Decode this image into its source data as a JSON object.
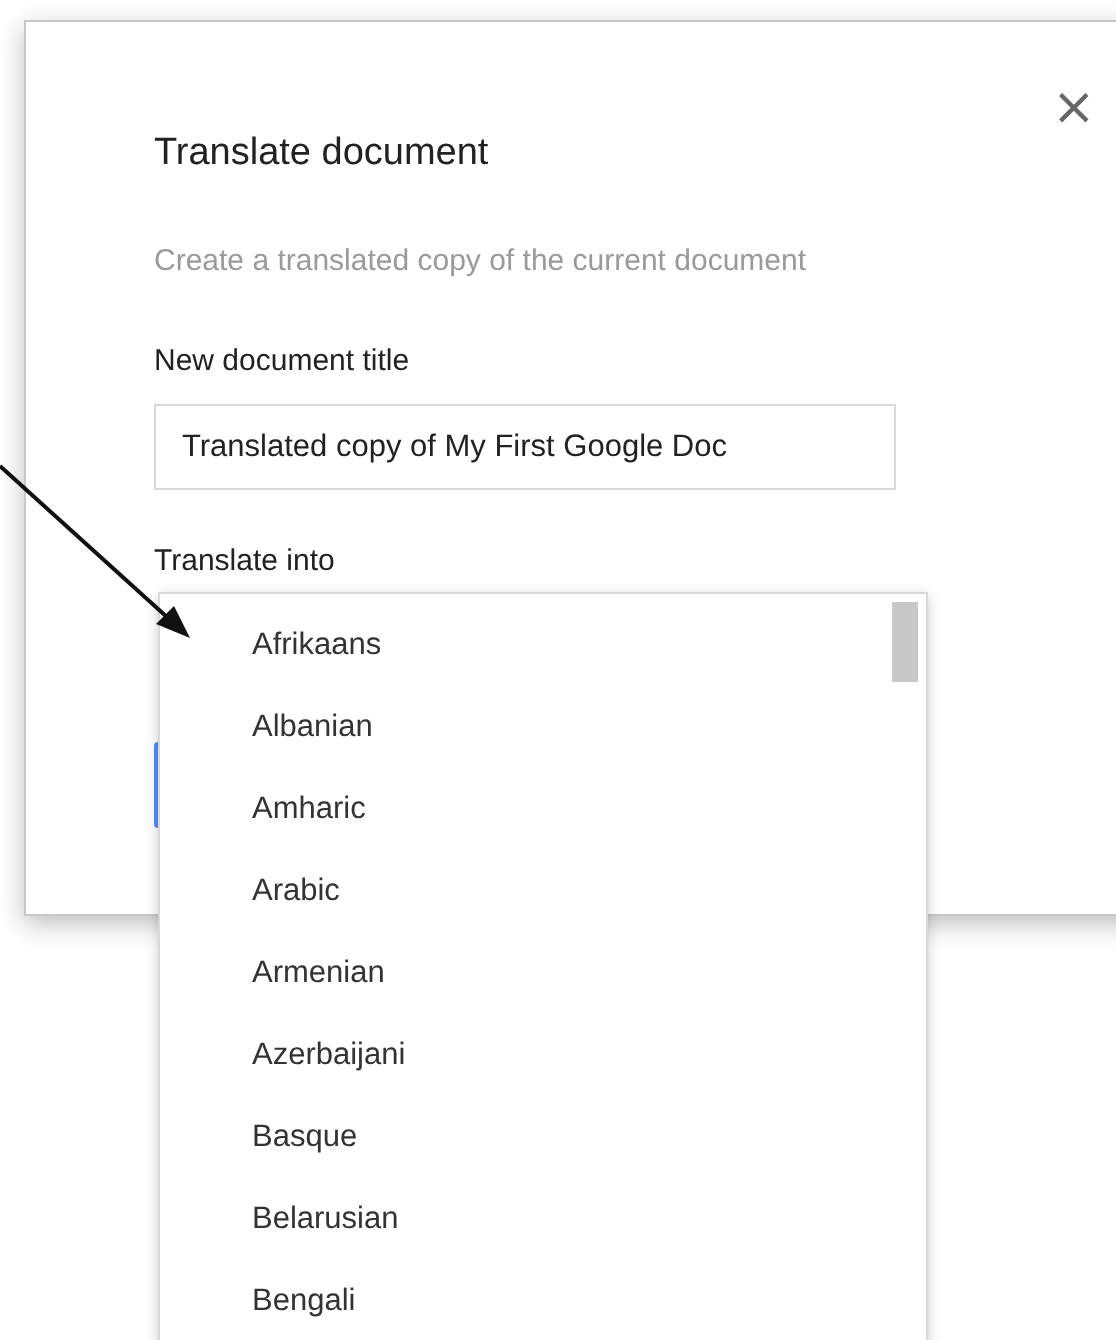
{
  "dialog": {
    "title": "Translate document",
    "close": "×",
    "subtitle": "Create a translated copy of the current document",
    "title_field": {
      "label": "New document title",
      "value": "Translated copy of My First Google Doc"
    },
    "language_field": {
      "label": "Translate into"
    }
  },
  "language_list": [
    {
      "label": "Afrikaans",
      "selected": false
    },
    {
      "label": "Albanian",
      "selected": false
    },
    {
      "label": "Amharic",
      "selected": false
    },
    {
      "label": "Arabic",
      "selected": false
    },
    {
      "label": "Armenian",
      "selected": false
    },
    {
      "label": "Azerbaijani",
      "selected": false
    },
    {
      "label": "Basque",
      "selected": false
    },
    {
      "label": "Belarusian",
      "selected": false
    },
    {
      "label": "Bengali",
      "selected": false
    }
  ]
}
